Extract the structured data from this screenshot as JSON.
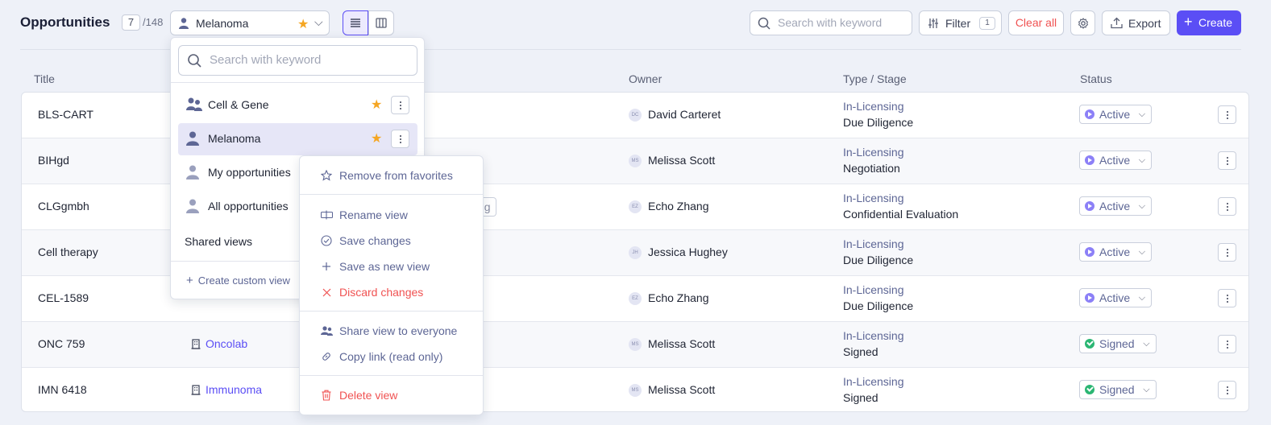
{
  "header": {
    "title": "Opportunities",
    "shown_count": "7",
    "total_count": "/148",
    "current_view": "Melanoma",
    "search_placeholder": "Search with keyword",
    "filter_label": "Filter",
    "filter_count": "1",
    "clear_all_label": "Clear all",
    "export_label": "Export",
    "create_label": "Create"
  },
  "table": {
    "columns": {
      "title": "Title",
      "owner": "Owner",
      "type_stage": "Type / Stage",
      "status": "Status"
    },
    "rows": [
      {
        "title": "BLS-CART",
        "company": "",
        "owner_initials": "DC",
        "owner": "David Carteret",
        "type": "In-Licensing",
        "stage": "Due Diligence",
        "status": "Active"
      },
      {
        "title": "BIHgd",
        "company": "",
        "owner_initials": "MS",
        "owner": "Melissa Scott",
        "type": "In-Licensing",
        "stage": "Negotiation",
        "status": "Active"
      },
      {
        "title": "CLGgmbh",
        "company": "",
        "owner_initials": "EZ",
        "owner": "Echo Zhang",
        "type": "In-Licensing",
        "stage": "Confidential Evaluation",
        "status": "Active",
        "chip": "ng"
      },
      {
        "title": "Cell therapy",
        "company": "",
        "owner_initials": "JH",
        "owner": "Jessica Hughey",
        "type": "In-Licensing",
        "stage": "Due Diligence",
        "status": "Active"
      },
      {
        "title": "CEL-1589",
        "company": "",
        "owner_initials": "EZ",
        "owner": "Echo Zhang",
        "type": "In-Licensing",
        "stage": "Due Diligence",
        "status": "Active"
      },
      {
        "title": "ONC 759",
        "company": "Oncolab",
        "owner_initials": "MS",
        "owner": "Melissa Scott",
        "type": "In-Licensing",
        "stage": "Signed",
        "status": "Signed"
      },
      {
        "title": "IMN 6418",
        "company": "Immunoma",
        "owner_initials": "MS",
        "owner": "Melissa Scott",
        "type": "In-Licensing",
        "stage": "Signed",
        "status": "Signed"
      }
    ]
  },
  "views_panel": {
    "search_placeholder": "Search with keyword",
    "items": [
      {
        "label": "Cell & Gene",
        "icon": "group-icon",
        "favorite": true
      },
      {
        "label": "Melanoma",
        "icon": "person-icon",
        "favorite": true,
        "selected": true
      },
      {
        "label": "My opportunities",
        "icon": "person-icon"
      },
      {
        "label": "All opportunities",
        "icon": "person-icon"
      }
    ],
    "shared_label": "Shared views",
    "create_label": "Create custom view"
  },
  "context_menu": {
    "remove_favorites": "Remove from favorites",
    "rename": "Rename view",
    "save_changes": "Save changes",
    "save_new": "Save as new view",
    "discard": "Discard changes",
    "share": "Share view to everyone",
    "copy_link": "Copy link (read only)",
    "delete": "Delete view"
  },
  "colors": {
    "accent": "#5b4ef5",
    "danger": "#f05252",
    "favorite": "#f5a623",
    "active_status": "#8c80f7",
    "signed_status": "#2bb673"
  }
}
